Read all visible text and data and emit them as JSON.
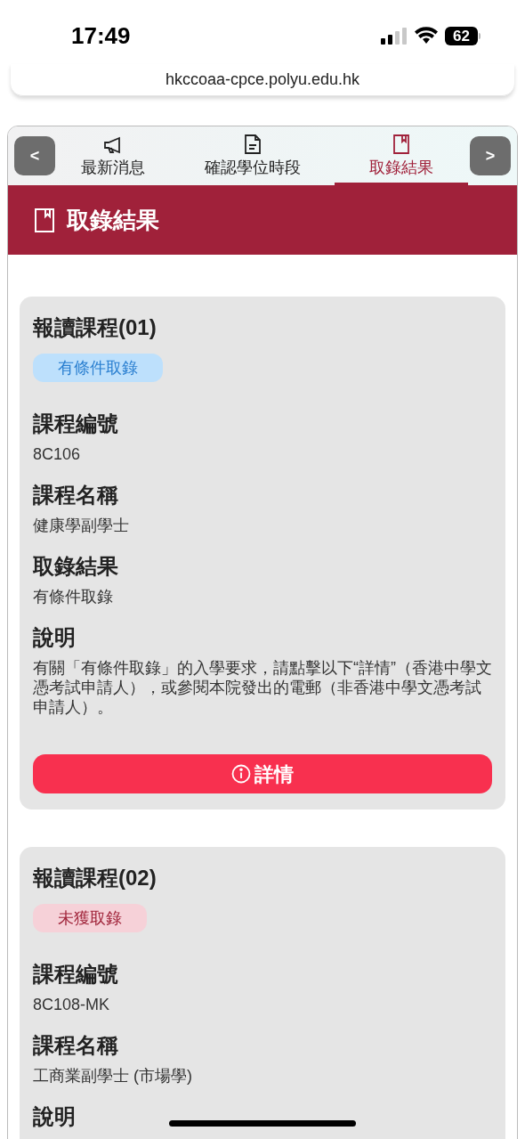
{
  "status_bar": {
    "time": "17:49",
    "battery": "62"
  },
  "address_bar": {
    "url": "hkccoaa-cpce.polyu.edu.hk"
  },
  "nav": {
    "prev": "<",
    "next": ">",
    "tabs": [
      {
        "label": "最新消息",
        "kind": "news",
        "selected": false
      },
      {
        "label": "確認學位時段",
        "kind": "confirm",
        "selected": false
      },
      {
        "label": "取錄結果",
        "kind": "result",
        "selected": true
      }
    ]
  },
  "header": {
    "title": "取錄結果"
  },
  "courses": [
    {
      "title": "報讀課程(01)",
      "status": {
        "label": "有條件取錄",
        "kind": "conditional"
      },
      "fields": [
        {
          "label": "課程編號",
          "value": "8C106"
        },
        {
          "label": "課程名稱",
          "value": "健康學副學士"
        },
        {
          "label": "取錄結果",
          "value": "有條件取錄"
        },
        {
          "label": "說明",
          "value": "有關「有條件取錄」的入學要求，請點擊以下“詳情”（香港中學文憑考試申請人），或參閱本院發出的電郵（非香港中學文憑考試申請人）。"
        }
      ],
      "button": "詳情"
    },
    {
      "title": "報讀課程(02)",
      "status": {
        "label": "未獲取錄",
        "kind": "rejected"
      },
      "fields": [
        {
          "label": "課程編號",
          "value": "8C108-MK"
        },
        {
          "label": "課程名稱",
          "value": "工商業副學士 (市場學)"
        },
        {
          "label": "說明"
        }
      ]
    }
  ]
}
